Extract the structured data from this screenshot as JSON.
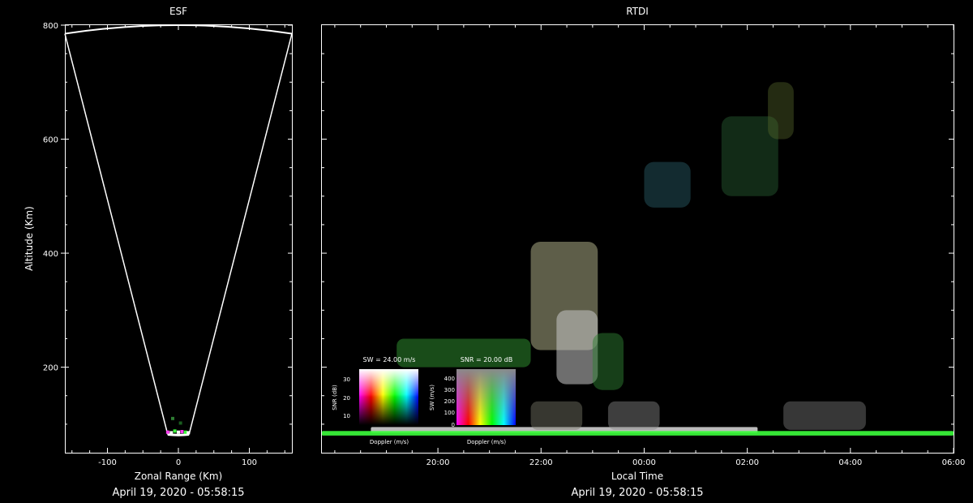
{
  "esf": {
    "title": "ESF",
    "xlabel": "Zonal Range (Km)",
    "ylabel": "Altitude (Km)",
    "timestamp": "April 19, 2020 - 05:58:15"
  },
  "rtdi": {
    "title": "RTDI",
    "xlabel": "Local Time",
    "timestamp": "April 19, 2020 - 05:58:15",
    "legend_sw": {
      "title": "SW = 24.00 m/s",
      "ylabel": "SNR (dB)",
      "xlabel": "Doppler (m/s)",
      "ticks": [
        "30",
        "20",
        "10"
      ]
    },
    "legend_snr": {
      "title": "SNR = 20.00 dB",
      "ylabel": "SW (m/s)",
      "xlabel": "Doppler (m/s)",
      "ticks": [
        "400",
        "300",
        "200",
        "100",
        "0"
      ]
    }
  },
  "chart_data": [
    {
      "type": "scatter",
      "title": "ESF",
      "xlabel": "Zonal Range (Km)",
      "ylabel": "Altitude (Km)",
      "xlim": [
        -160,
        160
      ],
      "ylim": [
        50,
        800
      ],
      "xticks": [
        -100,
        0,
        100
      ],
      "xtick_labels": [
        "-100",
        "0",
        "100"
      ],
      "yticks": [
        200,
        400,
        600,
        800
      ],
      "ytick_labels": [
        "200",
        "400",
        "600",
        "800"
      ],
      "fan_edges": [
        {
          "x": [
            -160,
            -15
          ],
          "y": [
            785,
            82
          ]
        },
        {
          "x": [
            160,
            15
          ],
          "y": [
            785,
            82
          ]
        }
      ],
      "echo_points": [
        {
          "x": -15,
          "y": 86,
          "color": "#ff3df0"
        },
        {
          "x": -10,
          "y": 85,
          "color": "#ffffff"
        },
        {
          "x": -5,
          "y": 88,
          "color": "#3dff3d"
        },
        {
          "x": 0,
          "y": 86,
          "color": "#ffffff"
        },
        {
          "x": 5,
          "y": 87,
          "color": "#ff3df0"
        },
        {
          "x": 10,
          "y": 86,
          "color": "#3dff3d"
        },
        {
          "x": 14,
          "y": 85,
          "color": "#ffffff"
        },
        {
          "x": -8,
          "y": 110,
          "color": "#2e7d32"
        },
        {
          "x": 3,
          "y": 102,
          "color": "#1b5e20"
        }
      ]
    },
    {
      "type": "heatmap",
      "title": "RTDI",
      "xlabel": "Local Time",
      "ylabel": "Altitude (Km)",
      "ylim": [
        50,
        800
      ],
      "x_range_hours": [
        17.75,
        30.0
      ],
      "xticks_hours": [
        20,
        22,
        24,
        26,
        28,
        30
      ],
      "xtick_labels": [
        "20:00",
        "22:00",
        "00:00",
        "02:00",
        "04:00",
        "06:00"
      ],
      "echo_regions": [
        {
          "x_hours": [
            18.7,
            26.2
          ],
          "alt": [
            85,
            95
          ],
          "color": "#dcdcdc",
          "opacity": 0.85
        },
        {
          "x_hours": [
            17.75,
            30.0
          ],
          "alt": [
            80,
            88
          ],
          "color": "#3cff3c",
          "opacity": 0.9
        },
        {
          "x_hours": [
            21.8,
            22.8
          ],
          "alt": [
            90,
            140
          ],
          "color": "#7a7a6a",
          "opacity": 0.45
        },
        {
          "x_hours": [
            23.3,
            24.3
          ],
          "alt": [
            90,
            140
          ],
          "color": "#8a8a8a",
          "opacity": 0.45
        },
        {
          "x_hours": [
            26.7,
            28.3
          ],
          "alt": [
            90,
            140
          ],
          "color": "#8a8a8a",
          "opacity": 0.4
        },
        {
          "x_hours": [
            19.2,
            21.8
          ],
          "alt": [
            200,
            250
          ],
          "color": "#2e8b2e",
          "opacity": 0.55
        },
        {
          "x_hours": [
            21.8,
            23.1
          ],
          "alt": [
            230,
            420
          ],
          "color": "#9c9c7a",
          "opacity": 0.6
        },
        {
          "x_hours": [
            22.3,
            23.1
          ],
          "alt": [
            170,
            300
          ],
          "color": "#c8c8c8",
          "opacity": 0.55
        },
        {
          "x_hours": [
            23.0,
            23.6
          ],
          "alt": [
            160,
            260
          ],
          "color": "#2e7d32",
          "opacity": 0.5
        },
        {
          "x_hours": [
            24.0,
            24.9
          ],
          "alt": [
            480,
            560
          ],
          "color": "#2b5f6b",
          "opacity": 0.45
        },
        {
          "x_hours": [
            25.5,
            26.6
          ],
          "alt": [
            500,
            640
          ],
          "color": "#2e6b3a",
          "opacity": 0.4
        },
        {
          "x_hours": [
            26.4,
            26.9
          ],
          "alt": [
            600,
            700
          ],
          "color": "#5a6b2e",
          "opacity": 0.4
        }
      ]
    }
  ]
}
